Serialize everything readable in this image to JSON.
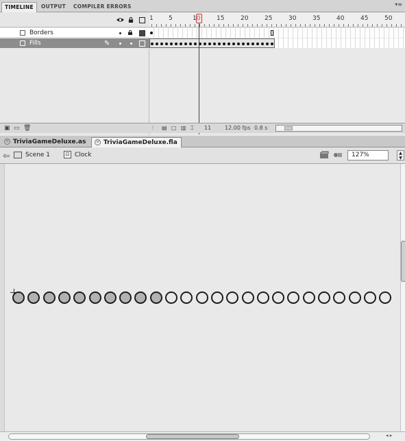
{
  "panel_tabs": [
    "TIMELINE",
    "OUTPUT",
    "COMPILER ERRORS"
  ],
  "layers": [
    {
      "name": "Borders",
      "selected": false
    },
    {
      "name": "Fills",
      "selected": true
    }
  ],
  "ruler_labels": [
    "1",
    "5",
    "10",
    "15",
    "20",
    "25",
    "30",
    "35",
    "40",
    "45",
    "50"
  ],
  "timeline": {
    "current_frame": 10,
    "last_frame": 26,
    "footer_frame": "11",
    "fps": "12.00 fps",
    "time": "0.8 s"
  },
  "doc_tabs": [
    "TriviaGameDeluxe.as",
    "TriviaGameDeluxe.fla"
  ],
  "active_doc_tab": 1,
  "breadcrumb": {
    "scene": "Scene 1",
    "symbol": "Clock"
  },
  "zoom": "127%",
  "stage": {
    "circle_count": 25,
    "filled_circles": 10
  },
  "colors": {
    "selected_layer": "#8d8d8d",
    "playhead": "#c04040",
    "stage_bg": "#e9e9e9",
    "filled_circle": "#b2b2b2"
  },
  "icons": {
    "eye": "eye-icon",
    "lock": "lock-icon",
    "outline": "outline-icon",
    "pencil": "pencil-icon",
    "back": "back-arrow-icon",
    "scene": "scene-icon",
    "symbol": "movie-clip-icon",
    "edit_scene": "edit-scene-icon",
    "edit_symbol": "edit-symbol-icon"
  }
}
